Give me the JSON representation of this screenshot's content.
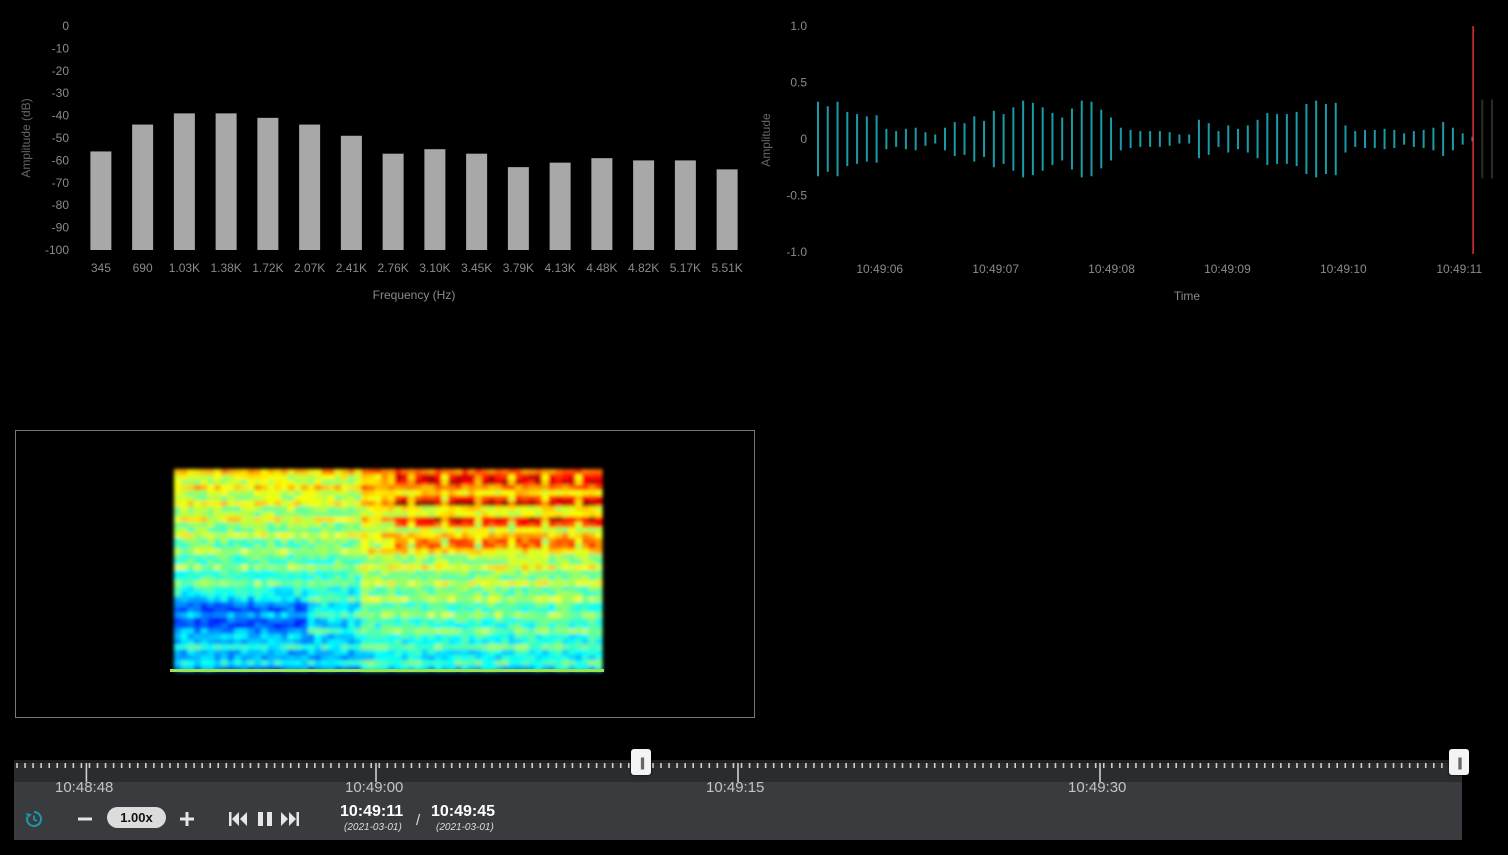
{
  "chart_data": [
    {
      "type": "bar",
      "title": "",
      "xlabel": "Frequency (Hz)",
      "ylabel": "Amplitude (dB)",
      "ylim": [
        -100,
        0
      ],
      "yticks": [
        "0",
        "-10",
        "-20",
        "-30",
        "-40",
        "-50",
        "-60",
        "-70",
        "-80",
        "-90",
        "-100"
      ],
      "categories": [
        "345",
        "690",
        "1.03K",
        "1.38K",
        "1.72K",
        "2.07K",
        "2.41K",
        "2.76K",
        "3.10K",
        "3.45K",
        "3.79K",
        "4.13K",
        "4.48K",
        "4.82K",
        "5.17K",
        "5.51K"
      ],
      "values": [
        -56,
        -44,
        -39,
        -39,
        -41,
        -44,
        -49,
        -57,
        -55,
        -57,
        -63,
        -61,
        -59,
        -60,
        -60,
        -64
      ],
      "grid": false,
      "bar_color": "#a8a8a8"
    },
    {
      "type": "line",
      "title": "",
      "xlabel": "Time",
      "ylabel": "Amplitude",
      "ylim": [
        -1.0,
        1.0
      ],
      "yticks": [
        "1.0",
        "0.5",
        "0",
        "-0.5",
        "-1.0"
      ],
      "xticks": [
        "10:49:06",
        "10:49:07",
        "10:49:08",
        "10:49:09",
        "10:49:10",
        "10:49:11"
      ],
      "x_start_time": "10:49:05.45",
      "x_end_time": "10:49:11.30",
      "amplitudes": [
        0.33,
        0.29,
        0.33,
        0.24,
        0.22,
        0.2,
        0.21,
        0.09,
        0.07,
        0.09,
        0.1,
        0.06,
        0.04,
        0.1,
        0.15,
        0.14,
        0.2,
        0.16,
        0.25,
        0.22,
        0.28,
        0.34,
        0.32,
        0.28,
        0.23,
        0.19,
        0.27,
        0.34,
        0.33,
        0.26,
        0.19,
        0.1,
        0.08,
        0.07,
        0.07,
        0.07,
        0.06,
        0.04,
        0.04,
        0.17,
        0.14,
        0.07,
        0.12,
        0.09,
        0.12,
        0.17,
        0.23,
        0.22,
        0.22,
        0.24,
        0.31,
        0.34,
        0.31,
        0.32,
        0.12,
        0.07,
        0.08,
        0.08,
        0.09,
        0.08,
        0.05,
        0.07,
        0.08,
        0.1,
        0.15,
        0.1,
        0.05,
        0.02,
        0.35,
        0.35
      ],
      "playhead_time": "10:49:11.12",
      "wave_color": "#1a9ba8",
      "playhead_color": "#e0323a",
      "grid": false
    }
  ],
  "spectrogram": {
    "colormap": "jet"
  },
  "timeline": {
    "labels": [
      "10:48:48",
      "10:49:00",
      "10:49:15",
      "10:49:30"
    ],
    "label_times": [
      "10:48:48",
      "10:49:00",
      "10:49:15",
      "10:49:30"
    ],
    "range_start": "10:48:45",
    "range_end": "10:49:45",
    "selection_start": "10:49:11",
    "selection_end": "10:49:45",
    "handle_glyph": "||"
  },
  "controls": {
    "reset_icon": "reset-icon",
    "zoom_out_icon": "minus-icon",
    "speed": "1.00x",
    "zoom_in_icon": "plus-icon",
    "skip_back_icon": "skip-back-icon",
    "pause_icon": "pause-icon",
    "skip_forward_icon": "skip-forward-icon",
    "current_time": "10:49:11",
    "current_date": "(2021-03-01)",
    "separator": "/",
    "end_time": "10:49:45",
    "end_date": "(2021-03-01)"
  },
  "colors": {
    "accent": "#1a9ba8",
    "control_bar": "#3a3b3e",
    "ruler": "#2a2c2e"
  }
}
